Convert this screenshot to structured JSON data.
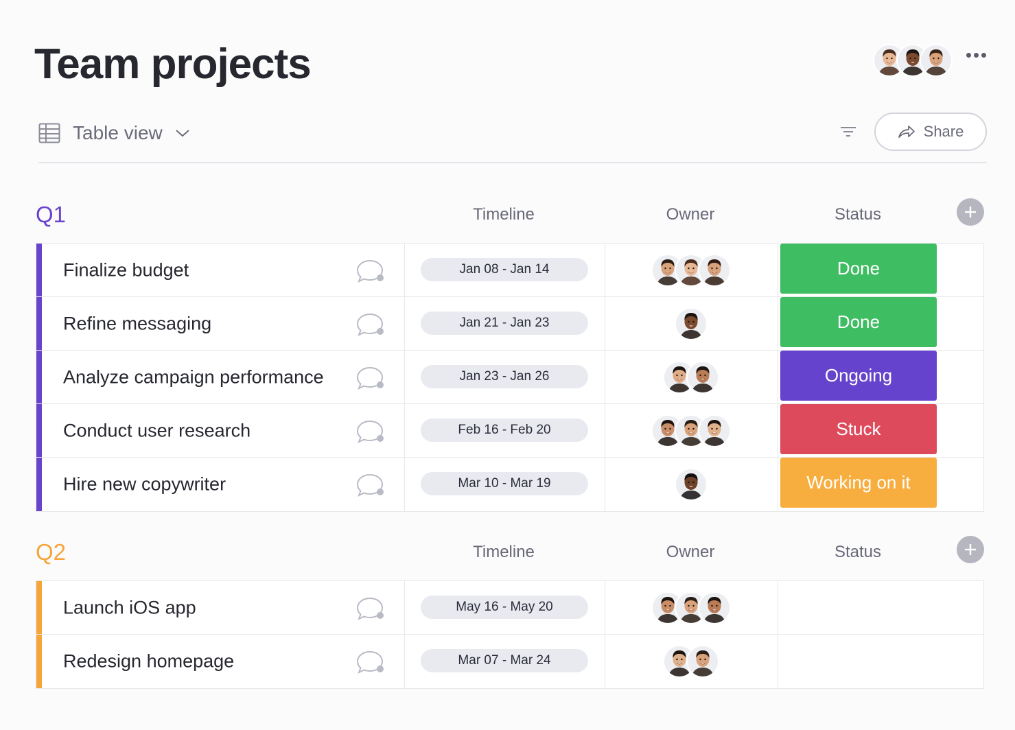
{
  "page": {
    "title": "Team projects"
  },
  "header": {
    "collaborators": [
      {
        "icon": "avatar-woman-brown-hair",
        "skin": "#e8b894",
        "hair": "#4a2c1c"
      },
      {
        "icon": "avatar-man-dark-skin",
        "skin": "#7b4a2e",
        "hair": "#1d1410"
      },
      {
        "icon": "avatar-man-smiling",
        "skin": "#d9a27a",
        "hair": "#3a2418"
      }
    ],
    "more_icon": "more-horizontal-icon"
  },
  "toolbar": {
    "view_icon": "table-icon",
    "view_label": "Table view",
    "chevron_icon": "chevron-down-icon",
    "filter_icon": "filter-icon",
    "share_icon": "share-arrow-icon",
    "share_label": "Share"
  },
  "colors": {
    "q1_accent": "#6a43cc",
    "q2_accent": "#f6a53a",
    "done": "#3fbd62",
    "ongoing": "#6543cc",
    "stuck": "#dc4a5c",
    "working": "#f8ad3f"
  },
  "groups": [
    {
      "title": "Q1",
      "color": "#6a43cc",
      "columns": {
        "timeline": "Timeline",
        "owner": "Owner",
        "status": "Status"
      },
      "rows": [
        {
          "name": "Finalize budget",
          "timeline": "Jan 08 - Jan 14",
          "owners": [
            {
              "skin": "#d9a27a",
              "hair": "#2a1d16"
            },
            {
              "skin": "#e8b894",
              "hair": "#4a2c1c"
            },
            {
              "skin": "#d6a07a",
              "hair": "#2e1c12"
            }
          ],
          "status": "Done",
          "status_color": "#3fbd62"
        },
        {
          "name": "Refine messaging",
          "timeline": "Jan 21 - Jan 23",
          "owners": [
            {
              "skin": "#7b4a2e",
              "hair": "#1d1410"
            }
          ],
          "status": "Done",
          "status_color": "#3fbd62"
        },
        {
          "name": "Analyze campaign performance",
          "timeline": "Jan 23 - Jan 26",
          "owners": [
            {
              "skin": "#e0ac86",
              "hair": "#1d1410"
            },
            {
              "skin": "#b97c56",
              "hair": "#1d1410"
            }
          ],
          "status": "Ongoing",
          "status_color": "#6543cc"
        },
        {
          "name": "Conduct user research",
          "timeline": "Feb 16 - Feb 20",
          "owners": [
            {
              "skin": "#c98e68",
              "hair": "#1d1410"
            },
            {
              "skin": "#d9a27a",
              "hair": "#2a1d16"
            },
            {
              "skin": "#e0b08a",
              "hair": "#1d1410"
            }
          ],
          "status": "Stuck",
          "status_color": "#dc4a5c"
        },
        {
          "name": "Hire new copywriter",
          "timeline": "Mar 10 - Mar 19",
          "owners": [
            {
              "skin": "#6e4128",
              "hair": "#141010"
            }
          ],
          "status": "Working on it",
          "status_color": "#f8ad3f"
        }
      ]
    },
    {
      "title": "Q2",
      "color": "#f6a53a",
      "columns": {
        "timeline": "Timeline",
        "owner": "Owner",
        "status": "Status"
      },
      "rows": [
        {
          "name": "Launch iOS app",
          "timeline": "May 16 - May 20",
          "owners": [
            {
              "skin": "#c98e68",
              "hair": "#1d1410"
            },
            {
              "skin": "#d9a27a",
              "hair": "#2a1d16"
            },
            {
              "skin": "#b97c56",
              "hair": "#1d1410"
            }
          ],
          "status": "",
          "status_color": ""
        },
        {
          "name": "Redesign homepage",
          "timeline": "Mar 07 - Mar 24",
          "owners": [
            {
              "skin": "#e0b08a",
              "hair": "#1d1410"
            },
            {
              "skin": "#d9a27a",
              "hair": "#2a1d16"
            }
          ],
          "status": "",
          "status_color": ""
        }
      ]
    }
  ]
}
